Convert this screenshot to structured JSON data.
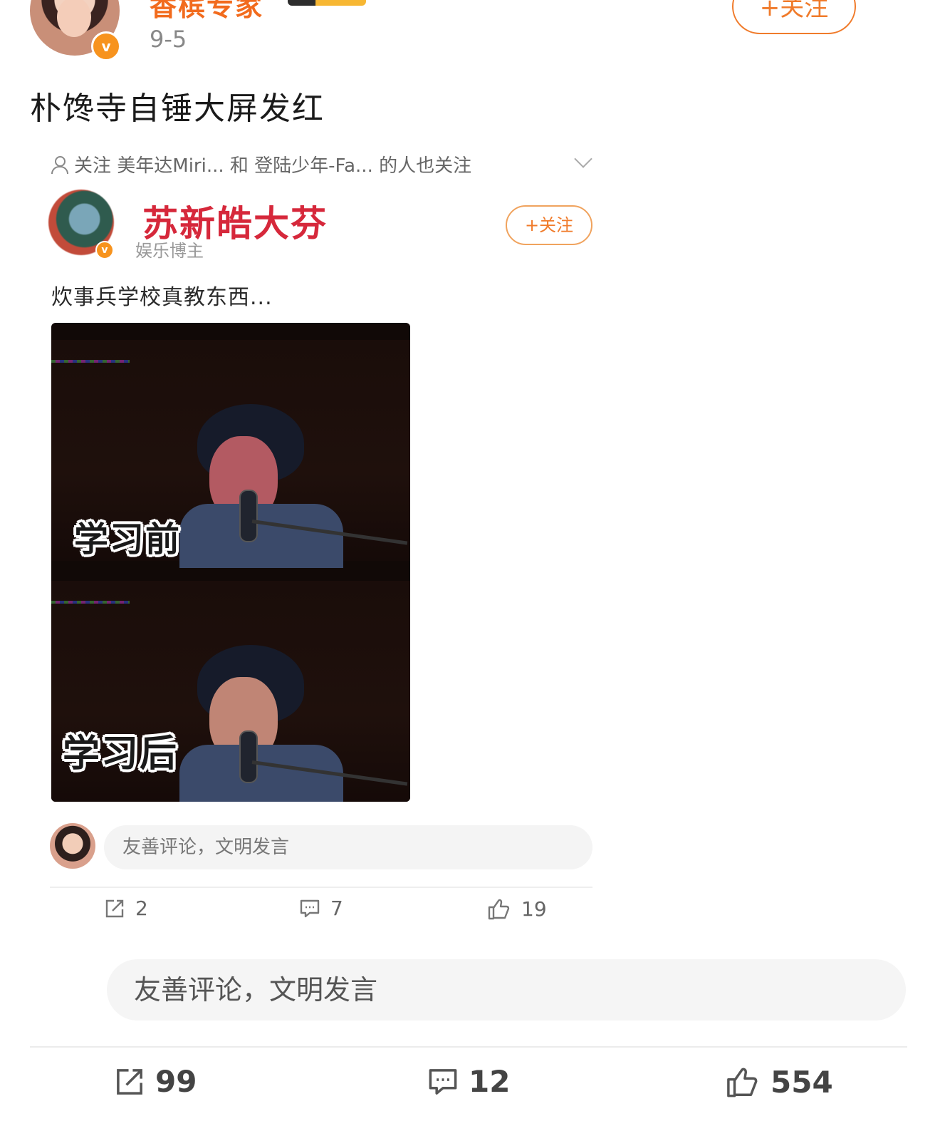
{
  "post": {
    "author_name": "香槟专家",
    "date": "9-5",
    "follow_label": "+关注",
    "text": "朴馋寺自锤大屏发红"
  },
  "retweet": {
    "recommend_text": "关注 美年达Miri... 和 登陆少年-Fa... 的人也关注",
    "author_name": "苏新皓大芬",
    "author_subtitle": "娱乐博主",
    "follow_label": "+关注",
    "text": "炊事兵学校真教东西...",
    "image_captions": [
      "学习前",
      "学习后"
    ],
    "comment_placeholder": "友善评论，文明发言",
    "actions": {
      "repost": "2",
      "comment": "7",
      "like": "19"
    }
  },
  "footer": {
    "comment_placeholder": "友善评论，文明发言",
    "actions": {
      "repost": "99",
      "comment": "12",
      "like": "554"
    }
  },
  "colors": {
    "accent": "#f07b2b",
    "retweet_name": "#d6283b"
  },
  "icons": [
    "verified-badge-icon",
    "person-icon",
    "chevron-down-icon",
    "repost-icon",
    "comment-icon",
    "like-icon"
  ]
}
